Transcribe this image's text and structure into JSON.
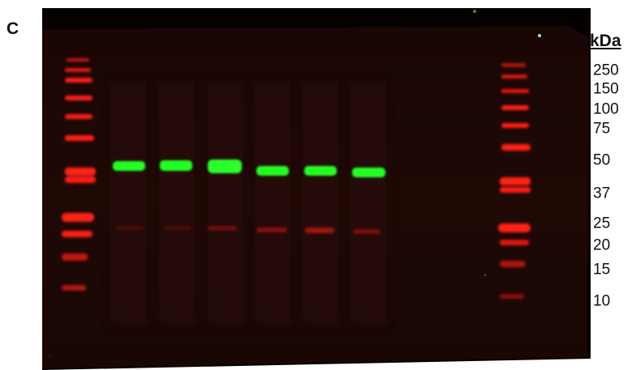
{
  "figure": {
    "panel_letter": "C",
    "axis_title": "kDa",
    "colors": {
      "membrane_background": "#1c0805",
      "ladder_band": "#ff1a10",
      "target_band": "#22ff22",
      "faint_band": "#7a0e0a"
    },
    "marker_labels": [
      "250",
      "150",
      "100",
      "75",
      "50",
      "37",
      "25",
      "20",
      "15",
      "10"
    ]
  }
}
